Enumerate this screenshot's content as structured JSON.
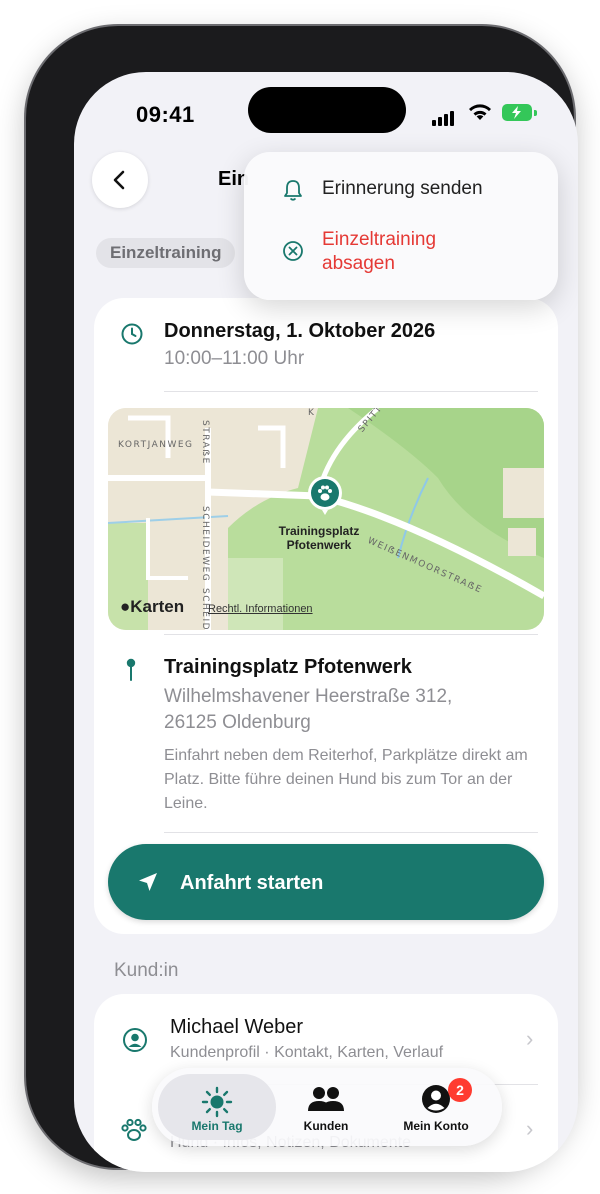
{
  "status_bar": {
    "time": "09:41"
  },
  "header": {
    "title_visible": "Ein",
    "category_chip": "Einzeltraining"
  },
  "menu": {
    "items": [
      {
        "label": "Erinnerung senden",
        "icon": "bell-icon",
        "color": "#222222"
      },
      {
        "label": "Einzeltraining absagen",
        "icon": "cancel-circle-icon",
        "color": "#e53935"
      }
    ]
  },
  "appointment": {
    "date": "Donnerstag, 1. Oktober 2026",
    "time_range": "10:00–11:00 Uhr"
  },
  "map": {
    "streets": [
      "KORTJANWEG",
      "STRAẞE",
      "SCHEIDEWEG",
      "SCHEID",
      "SPITTW",
      "WEIẞENMOORSTRAẞE",
      "K"
    ],
    "pin_label_line1": "Trainingsplatz",
    "pin_label_line2": "Pfotenwerk",
    "attribution": "Karten",
    "legal_link": "Rechtl. Informationen"
  },
  "location": {
    "name": "Trainingsplatz Pfotenwerk",
    "street": "Wilhelmshavener Heerstraße 312,",
    "city": "26125 Oldenburg",
    "note": "Einfahrt neben dem Reiterhof, Parkplätze direkt am Platz. Bitte führe deinen Hund bis zum Tor an der Leine."
  },
  "cta": {
    "label": "Anfahrt starten"
  },
  "customer_section": {
    "heading": "Kund:in",
    "customer_name": "Michael Weber",
    "customer_sub": "Kundenprofil · Kontakt, Karten, Verlauf",
    "dog_sub": "Hund · Infos, Notizen, Dokumente"
  },
  "tabbar": {
    "tabs": [
      {
        "label": "Mein Tag",
        "icon": "sun-icon",
        "active": true
      },
      {
        "label": "Kunden",
        "icon": "people-icon",
        "active": false
      },
      {
        "label": "Mein Konto",
        "icon": "account-icon",
        "active": false,
        "badge": "2"
      }
    ]
  },
  "colors": {
    "accent": "#19786d",
    "destructive": "#e53935",
    "background": "#f2f2f7"
  }
}
